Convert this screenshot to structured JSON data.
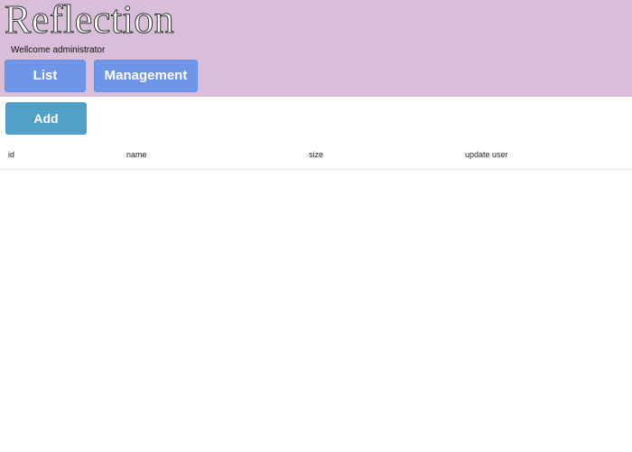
{
  "header": {
    "app_title": "Reflection",
    "welcome_text": "Wellcome administrator",
    "nav": {
      "list_label": "List",
      "management_label": "Management"
    }
  },
  "toolbar": {
    "add_label": "Add"
  },
  "table": {
    "columns": [
      "id",
      "name",
      "size",
      "update user"
    ],
    "rows": []
  },
  "colors": {
    "header_bg": "#d8bed9",
    "nav_button": "#6f95e8",
    "add_button": "#50a0c8"
  }
}
